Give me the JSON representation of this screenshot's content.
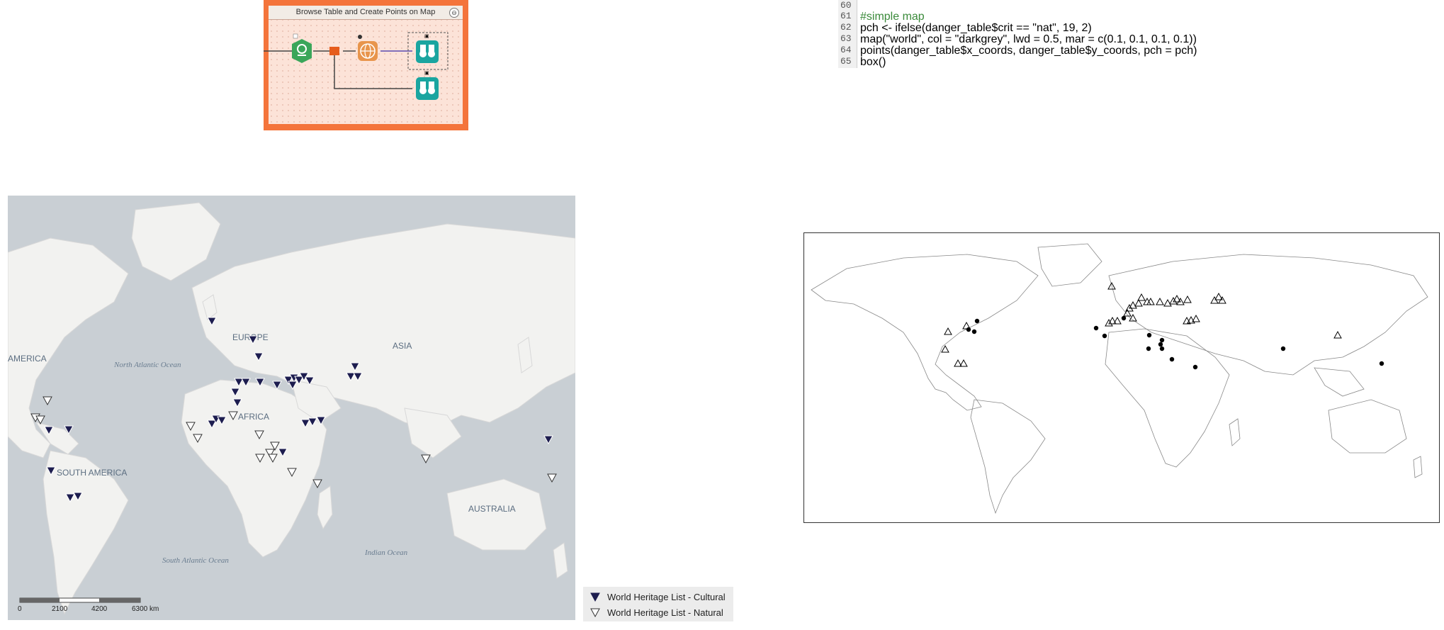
{
  "workflow": {
    "container_title": "Browse Table and Create Points on Map",
    "collapse_glyph": "⊖"
  },
  "code": {
    "line_numbers": [
      "60",
      "61",
      "62",
      "63",
      "64",
      "65"
    ],
    "lines": [
      "",
      "#simple map",
      "pch <- ifelse(danger_table$crit == \"nat\", 19, 2)",
      "map(\"world\", col = \"darkgrey\", lwd = 0.5, mar = c(0.1, 0.1, 0.1, 0.1))",
      "points(danger_table$x_coords, danger_table$y_coords, pch = pch)",
      "box()"
    ]
  },
  "map_left": {
    "labels": {
      "america": "AMERICA",
      "north_atlantic": "North Atlantic Ocean",
      "europe": "EUROPE",
      "asia": "ASIA",
      "africa": "AFRICA",
      "south_america": "SOUTH AMERICA",
      "south_atlantic": "South Atlantic Ocean",
      "indian_ocean": "Indian Ocean",
      "australia": "AUSTRALIA"
    },
    "scale": {
      "ticks": [
        "0",
        "2100",
        "4200",
        "6300 km"
      ]
    },
    "legend": [
      {
        "label": "World Heritage List - Cultural",
        "color": "#1d1d4f"
      },
      {
        "label": "World Heritage List - Natural",
        "color": "#ffffff"
      }
    ],
    "colors": {
      "ocean": "#c9cfd4",
      "land": "#f2f2f0",
      "border": "#d8d8d8",
      "cultural": "#1d1d4f"
    }
  },
  "map_right": {
    "colors": {
      "land_stroke": "#888888",
      "frame": "#333333"
    }
  }
}
